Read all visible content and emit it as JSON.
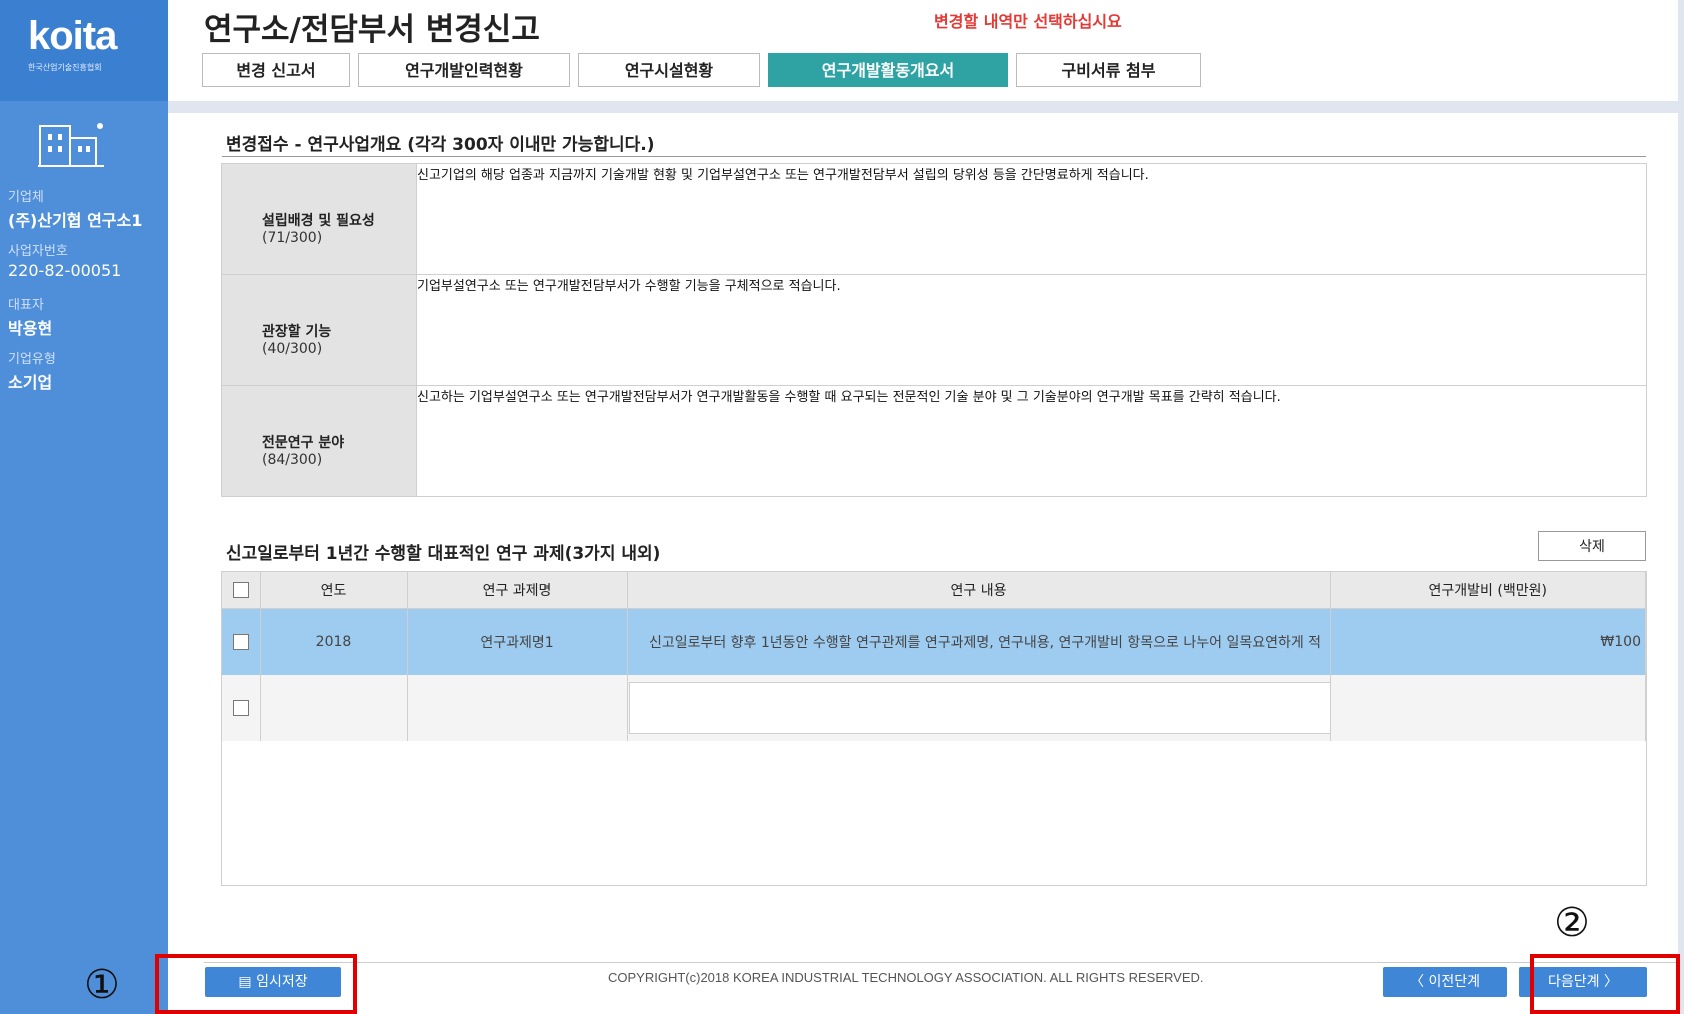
{
  "sidebar": {
    "logo_text": "koita",
    "logo_sub": "한국산업기술진흥협회",
    "company_label": "기업체",
    "company_value": "(주)산기협 연구소1",
    "bizno_label": "사업자번호",
    "bizno_value": "220-82-00051",
    "ceo_label": "대표자",
    "ceo_value": "박용현",
    "type_label": "기업유형",
    "type_value": "소기업"
  },
  "header": {
    "title": "연구소/전담부서 변경신고",
    "warning": "변경할 내역만 선택하십시요",
    "tabs": [
      {
        "label": "변경 신고서"
      },
      {
        "label": "연구개발인력현황"
      },
      {
        "label": "연구시설현황"
      },
      {
        "label": "연구개발활동개요서"
      },
      {
        "label": "구비서류 첨부"
      }
    ]
  },
  "overview": {
    "title": "변경접수 - 연구사업개요 (각각 300자 이내만 가능합니다.)",
    "rows": [
      {
        "name": "설립배경 및 필요성",
        "count": "(71/300)",
        "text": "신고기업의 해당 업종과 지금까지 기술개발 현황 및 기업부설연구소 또는 연구개발전담부서 설립의 당위성 등을 간단명료하게 적습니다."
      },
      {
        "name": "관장할 기능",
        "count": "(40/300)",
        "text": "기업부설연구소 또는 연구개발전담부서가 수행할 기능을 구체적으로 적습니다."
      },
      {
        "name": "전문연구 분야",
        "count": "(84/300)",
        "text": "신고하는 기업부설연구소 또는 연구개발전담부서가 연구개발활동을 수행할 때 요구되는 전문적인 기술 분야 및 그 기술분야의 연구개발 목표를 간략히 적습니다."
      }
    ]
  },
  "tasks": {
    "title": "신고일로부터 1년간 수행할 대표적인 연구 과제(3가지 내외)",
    "delete_label": "삭제",
    "headers": [
      "연도",
      "연구 과제명",
      "연구 내용",
      "연구개발비 (백만원)"
    ],
    "row1": {
      "year": "2018",
      "name": "연구과제명1",
      "content": "신고일로부터 향후 1년동안 수행할 연구관제를 연구과제명, 연구내용, 연구개발비 항목으로 나누어 일목요연하게 적",
      "cost": "₩100"
    }
  },
  "footer": {
    "copyright": "COPYRIGHT(c)2018 KOREA INDUSTRIAL TECHNOLOGY ASSOCIATION. ALL RIGHTS RESERVED.",
    "temp_save": "임시저장",
    "prev": "〈  이전단계",
    "next": "다음단계  〉"
  },
  "annotations": {
    "one": "①",
    "two": "②"
  }
}
